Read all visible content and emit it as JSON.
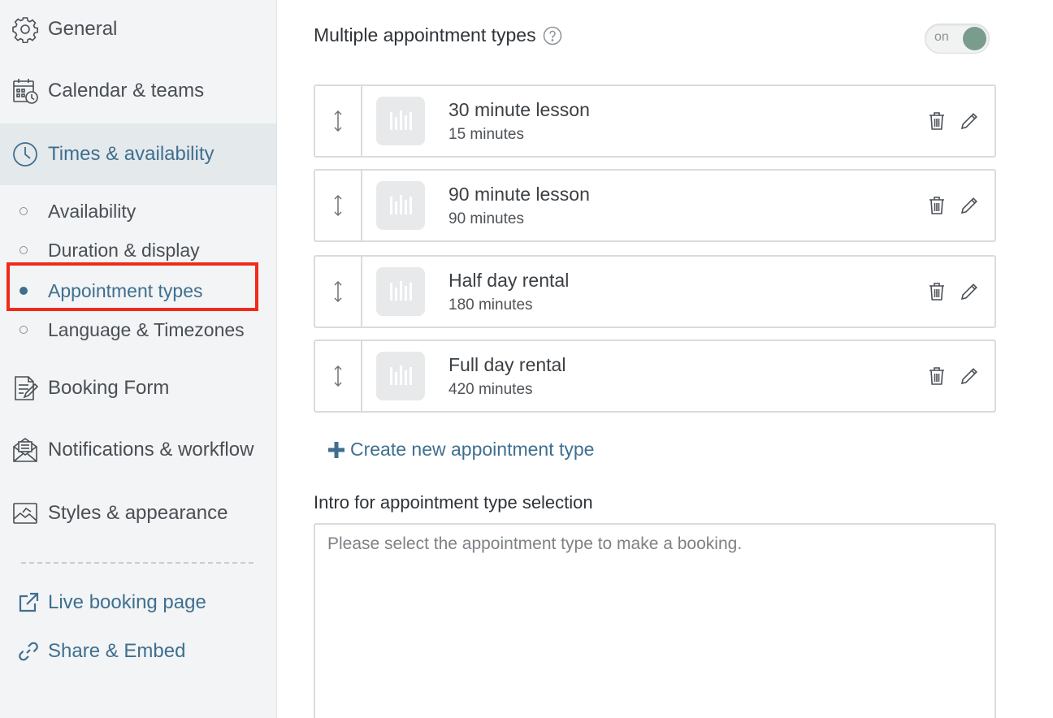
{
  "sidebar": {
    "nav": [
      {
        "label": "General",
        "icon": "gear-icon"
      },
      {
        "label": "Calendar & teams",
        "icon": "calendar-clock-icon"
      },
      {
        "label": "Times & availability",
        "icon": "clock-icon"
      }
    ],
    "sub_items": [
      {
        "label": "Availability"
      },
      {
        "label": "Duration & display"
      },
      {
        "label": "Appointment types"
      },
      {
        "label": "Language & Timezones"
      }
    ],
    "nav2": [
      {
        "label": "Booking Form",
        "icon": "form-icon"
      },
      {
        "label": "Notifications & workflow",
        "icon": "envelope-icon"
      },
      {
        "label": "Styles & appearance",
        "icon": "picture-icon"
      }
    ],
    "links": [
      {
        "label": "Live booking page",
        "icon": "external-link-icon"
      },
      {
        "label": "Share & Embed",
        "icon": "link-icon"
      }
    ]
  },
  "main": {
    "title": "Multiple appointment types",
    "toggle_label": "on",
    "types": [
      {
        "name": "30 minute lesson",
        "duration": "15 minutes"
      },
      {
        "name": "90 minute lesson",
        "duration": "90 minutes"
      },
      {
        "name": "Half day rental",
        "duration": "180 minutes"
      },
      {
        "name": "Full day rental",
        "duration": "420 minutes"
      }
    ],
    "create_label": "Create new appointment type",
    "intro_label": "Intro for appointment type selection",
    "intro_placeholder": "Please select the appointment type to make a booking."
  },
  "colors": {
    "accent": "#3f6f8f",
    "highlight": "#f02a1a",
    "toggle_on": "#7a9c8d"
  }
}
